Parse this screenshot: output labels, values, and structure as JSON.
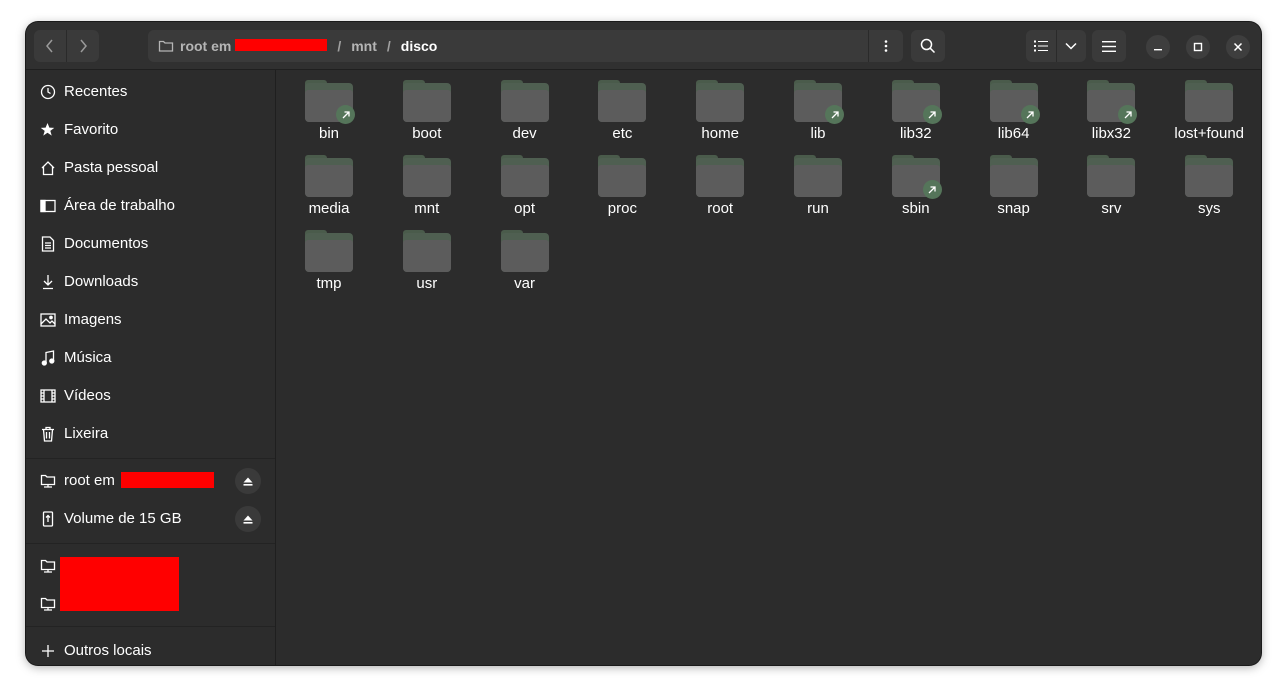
{
  "header": {
    "path_host_prefix": "root em",
    "path_segments": [
      "mnt",
      "disco"
    ],
    "separator": "/"
  },
  "sidebar": {
    "places": [
      {
        "label": "Recentes",
        "icon": "clock-icon"
      },
      {
        "label": "Favorito",
        "icon": "star-icon"
      },
      {
        "label": "Pasta pessoal",
        "icon": "home-icon"
      },
      {
        "label": "Área de trabalho",
        "icon": "desktop-icon"
      },
      {
        "label": "Documentos",
        "icon": "document-icon"
      },
      {
        "label": "Downloads",
        "icon": "download-icon"
      },
      {
        "label": "Imagens",
        "icon": "image-icon"
      },
      {
        "label": "Música",
        "icon": "music-icon"
      },
      {
        "label": "Vídeos",
        "icon": "video-icon"
      },
      {
        "label": "Lixeira",
        "icon": "trash-icon"
      }
    ],
    "devices": [
      {
        "label": "root em",
        "icon": "network-folder-icon"
      },
      {
        "label": "Volume de 15 GB",
        "icon": "usb-drive-icon"
      }
    ],
    "other_locations": "Outros locais"
  },
  "files": [
    {
      "name": "bin",
      "link": true
    },
    {
      "name": "boot",
      "link": false
    },
    {
      "name": "dev",
      "link": false
    },
    {
      "name": "etc",
      "link": false
    },
    {
      "name": "home",
      "link": false
    },
    {
      "name": "lib",
      "link": true
    },
    {
      "name": "lib32",
      "link": true
    },
    {
      "name": "lib64",
      "link": true
    },
    {
      "name": "libx32",
      "link": true
    },
    {
      "name": "lost+found",
      "link": false
    },
    {
      "name": "media",
      "link": false
    },
    {
      "name": "mnt",
      "link": false
    },
    {
      "name": "opt",
      "link": false
    },
    {
      "name": "proc",
      "link": false
    },
    {
      "name": "root",
      "link": false
    },
    {
      "name": "run",
      "link": false
    },
    {
      "name": "sbin",
      "link": true
    },
    {
      "name": "snap",
      "link": false
    },
    {
      "name": "srv",
      "link": false
    },
    {
      "name": "sys",
      "link": false
    },
    {
      "name": "tmp",
      "link": false
    },
    {
      "name": "usr",
      "link": false
    },
    {
      "name": "var",
      "link": false
    }
  ],
  "colors": {
    "window_bg": "#2c2c2c",
    "folder": "#5c5c5c",
    "folder_accent": "#4f5f51",
    "redaction": "#ff0000"
  }
}
